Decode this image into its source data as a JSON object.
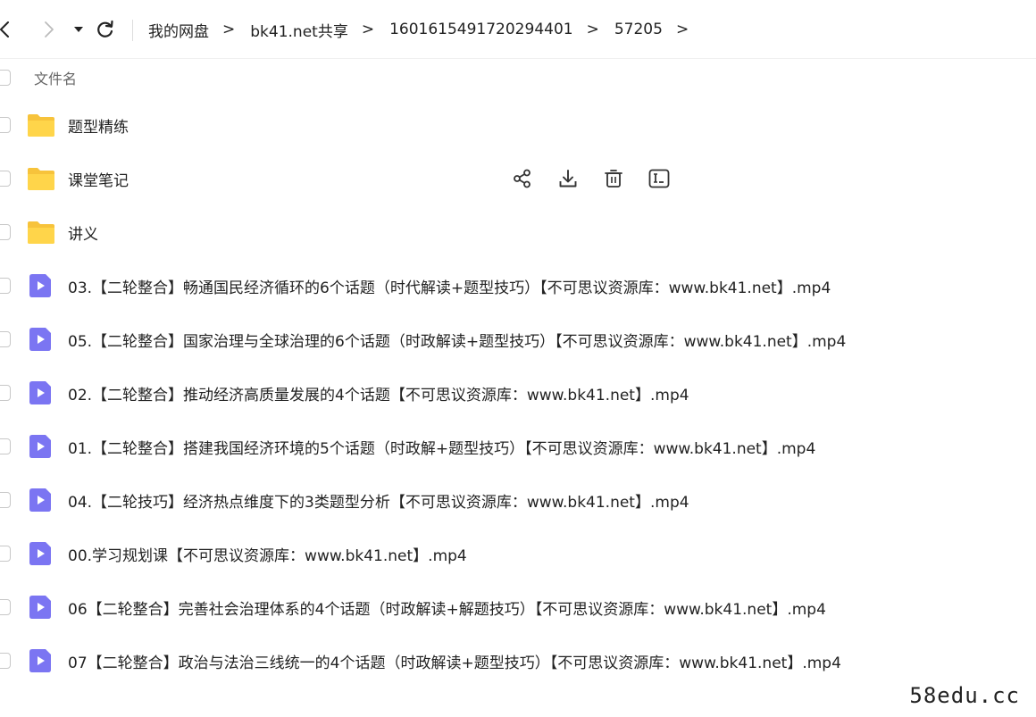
{
  "nav": {
    "breadcrumbs": [
      "我的网盘",
      "bk41.net共享",
      "1601615491720294401",
      "57205"
    ],
    "separator": ">"
  },
  "list": {
    "header_label": "文件名",
    "items": [
      {
        "name": "题型精练",
        "type": "folder",
        "icon": "folder-icon"
      },
      {
        "name": "课堂笔记",
        "type": "folder",
        "icon": "folder-icon",
        "hovered": true
      },
      {
        "name": "讲义",
        "type": "folder",
        "icon": "folder-icon"
      },
      {
        "name": "03.【二轮整合】畅通国民经济循环的6个话题（时代解读+题型技巧）【不可思议资源库：www.bk41.net】.mp4",
        "type": "video",
        "icon": "video-file-icon"
      },
      {
        "name": "05.【二轮整合】国家治理与全球治理的6个话题（时政解读+题型技巧）【不可思议资源库：www.bk41.net】.mp4",
        "type": "video",
        "icon": "video-file-icon"
      },
      {
        "name": "02.【二轮整合】推动经济高质量发展的4个话题【不可思议资源库：www.bk41.net】.mp4",
        "type": "video",
        "icon": "video-file-icon"
      },
      {
        "name": "01.【二轮整合】搭建我国经济环境的5个话题（时政解+题型技巧）【不可思议资源库：www.bk41.net】.mp4",
        "type": "video",
        "icon": "video-file-icon"
      },
      {
        "name": "04.【二轮技巧】经济热点维度下的3类题型分析【不可思议资源库：www.bk41.net】.mp4",
        "type": "video",
        "icon": "video-file-icon"
      },
      {
        "name": "00.学习规划课【不可思议资源库：www.bk41.net】.mp4",
        "type": "video",
        "icon": "video-file-icon"
      },
      {
        "name": "06【二轮整合】完善社会治理体系的4个话题（时政解读+解题技巧）【不可思议资源库：www.bk41.net】.mp4",
        "type": "video",
        "icon": "video-file-icon"
      },
      {
        "name": "07【二轮整合】政治与法治三线统一的4个话题（时政解读+题型技巧）【不可思议资源库：www.bk41.net】.mp4",
        "type": "video",
        "icon": "video-file-icon"
      }
    ]
  },
  "watermark": "58edu.cc",
  "colors": {
    "folder": "#FFD54A",
    "folder_tab": "#F7C33B",
    "video": "#7B75F2",
    "icon_stroke": "#333333"
  }
}
